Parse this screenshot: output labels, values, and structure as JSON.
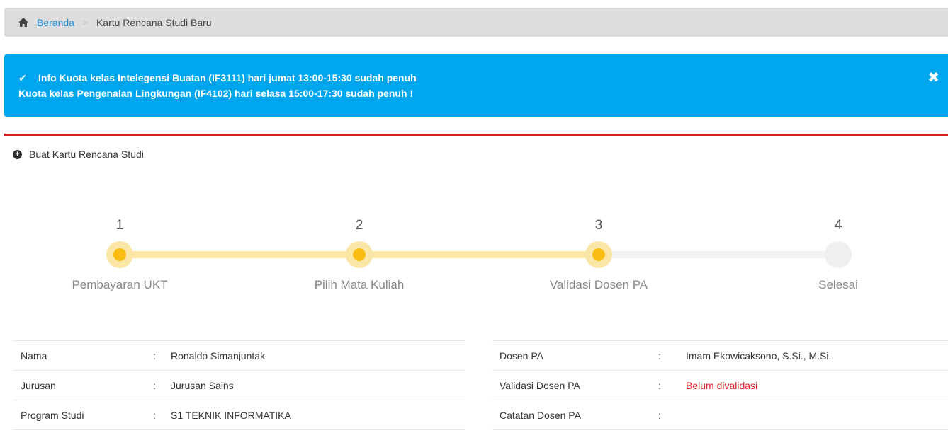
{
  "breadcrumb": {
    "home_label": "Beranda",
    "separator": ">",
    "current": "Kartu Rencana Studi Baru"
  },
  "alert": {
    "line1": "Info Kuota kelas Intelegensi Buatan (IF3111) hari jumat 13:00-15:30 sudah penuh",
    "line2": "Kuota kelas Pengenalan Lingkungan (IF4102) hari selasa 15:00-17:30 sudah penuh !",
    "close": "✖"
  },
  "box": {
    "title": "Buat Kartu Rencana Studi",
    "accent_color": "#dd1f26"
  },
  "steps": [
    {
      "number": "1",
      "label": "Pembayaran UKT",
      "done": true
    },
    {
      "number": "2",
      "label": "Pilih Mata Kuliah",
      "done": true
    },
    {
      "number": "3",
      "label": "Validasi Dosen PA",
      "done": true
    },
    {
      "number": "4",
      "label": "Selesai",
      "done": false
    }
  ],
  "student_info": [
    {
      "key": "Nama",
      "sep": ":",
      "value": "Ronaldo Simanjuntak"
    },
    {
      "key": "Jurusan",
      "sep": ":",
      "value": "Jurusan Sains"
    },
    {
      "key": "Program Studi",
      "sep": ":",
      "value": "S1 TEKNIK INFORMATIKA"
    }
  ],
  "advisor_info": [
    {
      "key": "Dosen PA",
      "sep": ":",
      "value": "Imam Ekowicaksono, S.Si., M.Si."
    },
    {
      "key": "Validasi Dosen PA",
      "sep": ":",
      "value": "Belum divalidasi",
      "status": "error"
    },
    {
      "key": "Catatan Dosen PA",
      "sep": ":",
      "value": ""
    }
  ],
  "colors": {
    "alert_bg": "#00a7ef",
    "step_active": "#fbbd14",
    "step_active_ring": "#fbe6a5",
    "step_inactive": "#f0f0f0"
  }
}
